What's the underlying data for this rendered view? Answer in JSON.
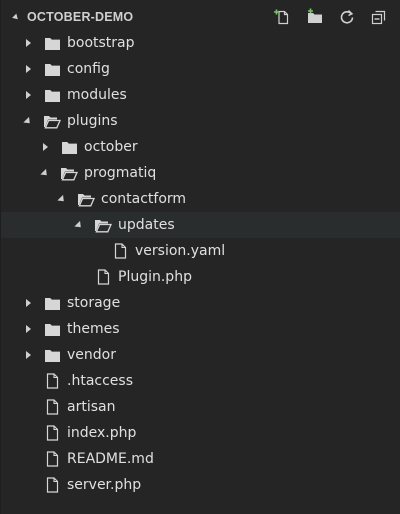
{
  "header": {
    "title": "OCTOBER-DEMO",
    "actions": [
      "new-file-icon",
      "new-folder-icon",
      "refresh-icon",
      "collapse-all-icon"
    ]
  },
  "tree": [
    {
      "label": "bootstrap",
      "type": "folder",
      "expanded": false,
      "depth": 0
    },
    {
      "label": "config",
      "type": "folder",
      "expanded": false,
      "depth": 0
    },
    {
      "label": "modules",
      "type": "folder",
      "expanded": false,
      "depth": 0
    },
    {
      "label": "plugins",
      "type": "folder",
      "expanded": true,
      "depth": 0
    },
    {
      "label": "october",
      "type": "folder",
      "expanded": false,
      "depth": 1
    },
    {
      "label": "progmatiq",
      "type": "folder",
      "expanded": true,
      "depth": 1
    },
    {
      "label": "contactform",
      "type": "folder",
      "expanded": true,
      "depth": 2
    },
    {
      "label": "updates",
      "type": "folder",
      "expanded": true,
      "depth": 3,
      "selected": true
    },
    {
      "label": "version.yaml",
      "type": "file",
      "depth": 4
    },
    {
      "label": "Plugin.php",
      "type": "file",
      "depth": 3
    },
    {
      "label": "storage",
      "type": "folder",
      "expanded": false,
      "depth": 0
    },
    {
      "label": "themes",
      "type": "folder",
      "expanded": false,
      "depth": 0
    },
    {
      "label": "vendor",
      "type": "folder",
      "expanded": false,
      "depth": 0
    },
    {
      "label": ".htaccess",
      "type": "file",
      "depth": 0
    },
    {
      "label": "artisan",
      "type": "file",
      "depth": 0
    },
    {
      "label": "index.php",
      "type": "file",
      "depth": 0
    },
    {
      "label": "README.md",
      "type": "file",
      "depth": 0
    },
    {
      "label": "server.php",
      "type": "file",
      "depth": 0
    }
  ],
  "colors": {
    "background": "#252526",
    "text": "#e0e0e0",
    "icon": "#d0d0d0",
    "accent_green": "#7ec16e"
  }
}
